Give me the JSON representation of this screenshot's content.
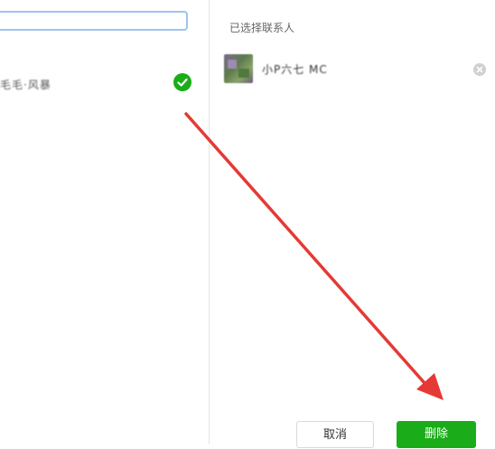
{
  "left": {
    "search": {
      "value": "",
      "placeholder": ""
    },
    "contacts": [
      {
        "name": "毛毛·风暴",
        "selected": true
      }
    ]
  },
  "right": {
    "title": "已选择联系人",
    "selected": [
      {
        "name": "小P六七 MC"
      }
    ]
  },
  "buttons": {
    "cancel": "取消",
    "delete": "删除"
  },
  "colors": {
    "accent": "#1aad19",
    "search_border": "#9cc4f0",
    "annotation_arrow": "#e53935"
  },
  "icons": {
    "check": "check-circle-icon",
    "remove": "close-circle-icon"
  }
}
